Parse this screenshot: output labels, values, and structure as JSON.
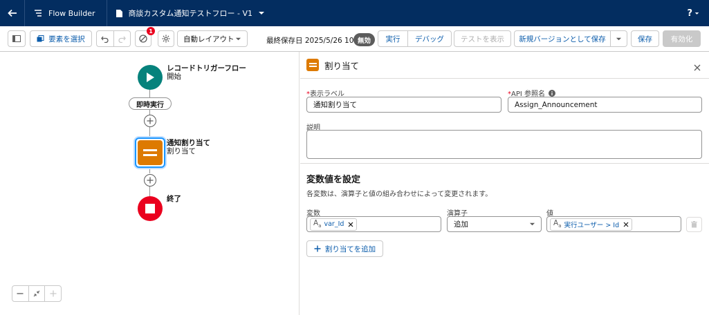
{
  "topbar": {
    "app_name": "Flow Builder",
    "flow_title": "商談カスタム通知テストフロー - V1",
    "help_label": "?"
  },
  "toolbar": {
    "select_elements_label": "要素を選択",
    "error_count": "1",
    "layout_label": "自動レイアウト",
    "last_saved": "最終保存日 2025/5/26 10:45",
    "status_badge": "無効",
    "run_label": "実行",
    "debug_label": "デバッグ",
    "view_tests_label": "テストを表示",
    "save_as_new_label": "新規バージョンとして保存",
    "save_label": "保存",
    "activate_label": "有効化"
  },
  "canvas": {
    "start_title": "レコードトリガーフロー",
    "start_sub": "開始",
    "immediate_label": "即時実行",
    "assign_title": "通知割り当て",
    "assign_sub": "割り当て",
    "end_title": "終了"
  },
  "panel": {
    "title": "割り当て",
    "label_field_label": "表示ラベル",
    "label_value": "通知割り当て",
    "api_field_label": "API 参照名",
    "api_value": "Assign_Announcement",
    "desc_label": "説明",
    "section_title": "変数値を設定",
    "section_desc": "各変数は、演算子と値の組み合わせによって変更されます。",
    "variable_label": "変数",
    "operator_label": "演算子",
    "value_label": "値",
    "variable_value": "var_Id",
    "operator_value": "追加",
    "value_value": "実行ユーザー > Id",
    "add_assignment_label": "割り当てを追加"
  },
  "colors": {
    "topbar": "#032d60",
    "start_node": "#06827c",
    "assign_node": "#dd7a01",
    "end_node": "#ea001e",
    "brand": "#0176d3"
  }
}
